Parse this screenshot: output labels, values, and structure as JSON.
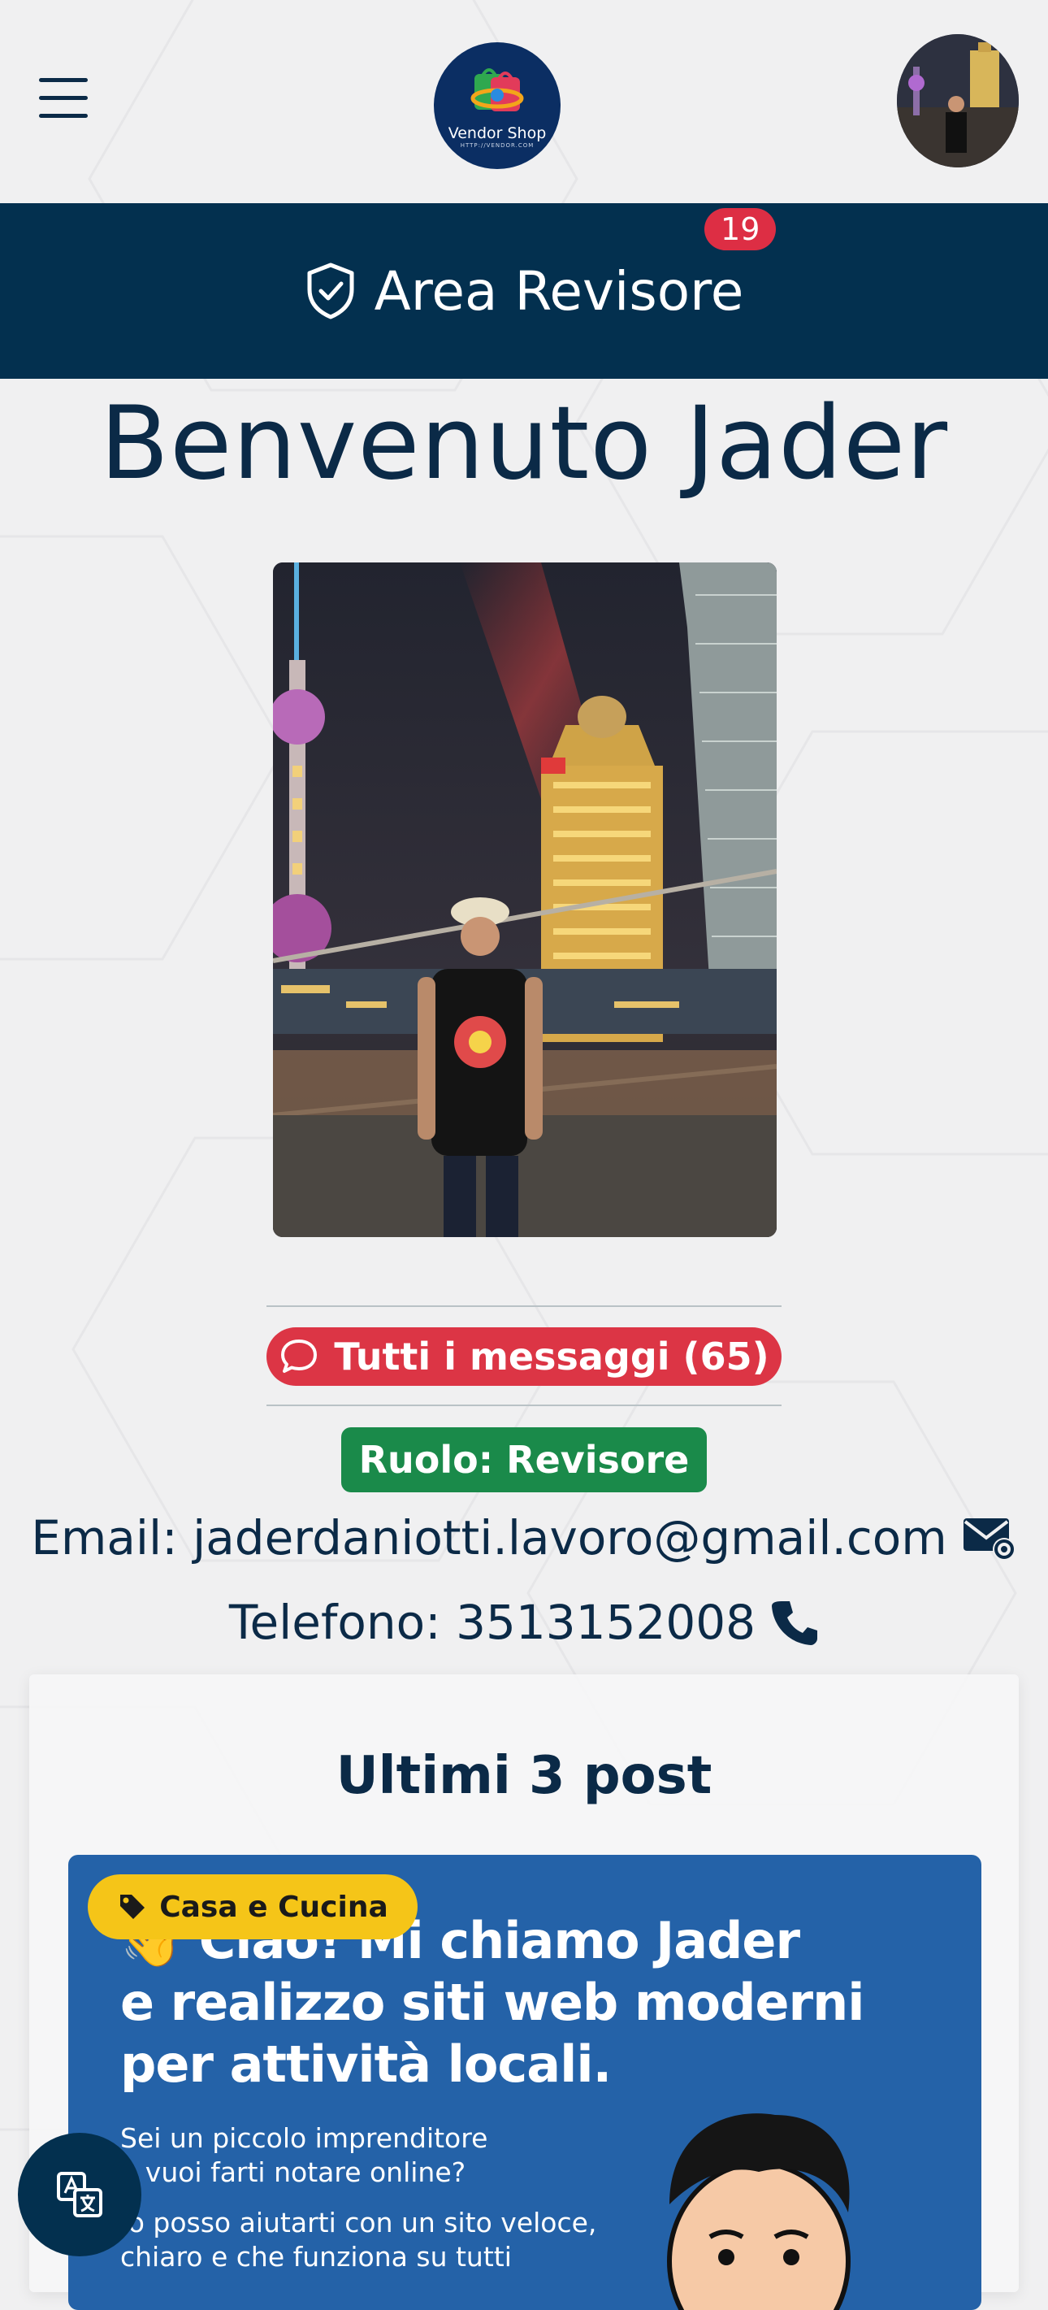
{
  "header": {
    "logo_name": "Vendor Shop",
    "logo_url": "HTTP://VENDOR.COM"
  },
  "review_area": {
    "label": "Area Revisore",
    "badge_count": "19"
  },
  "welcome": "Benvenuto Jader",
  "messages_button": "Tutti i messaggi (65)",
  "role": "Ruolo: Revisore",
  "email_line": "Email: jaderdaniotti.lavoro@gmail.com",
  "phone_line": "Telefono: 3513152008",
  "posts_section": {
    "title": "Ultimi 3 post",
    "posts": [
      {
        "category": "Casa e Cucina",
        "headline_lines": [
          "👋 Ciao! Mi chiamo Jader",
          "e realizzo siti web moderni",
          "per attività locali."
        ],
        "sub_lines": [
          "Sei un piccolo imprenditore",
          "e vuoi farti notare online?",
          "",
          "Io posso aiutarti con un sito veloce,",
          "chiaro e che funziona su tutti"
        ]
      }
    ]
  },
  "colors": {
    "navy": "#03304f",
    "danger": "#dc3545",
    "success": "#1a8a4a",
    "warning": "#f5c518",
    "post_blue": "#2462a8"
  },
  "icons": [
    "menu-icon",
    "shield-check-icon",
    "chat-bubble-icon",
    "envelope-at-icon",
    "telephone-icon",
    "tag-icon",
    "translate-icon"
  ]
}
